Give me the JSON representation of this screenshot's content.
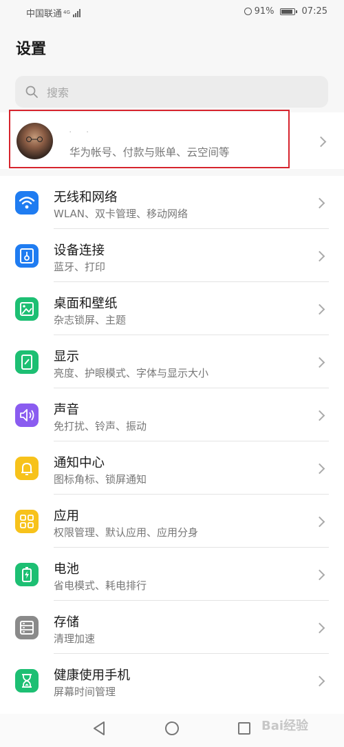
{
  "status_bar": {
    "carrier": "中国联通",
    "network": "4G",
    "battery_percent": "91%",
    "time": "07:25",
    "icons": [
      "signal-icon",
      "alarm-icon",
      "battery-icon"
    ]
  },
  "header": {
    "title": "设置"
  },
  "search": {
    "placeholder": "搜索"
  },
  "account": {
    "name": "· ·",
    "subtitle": "华为帐号、付款与账单、云空间等"
  },
  "settings": [
    {
      "title": "无线和网络",
      "subtitle": "WLAN、双卡管理、移动网络",
      "icon": "wifi-icon",
      "color": "#1f7cf1"
    },
    {
      "title": "设备连接",
      "subtitle": "蓝牙、打印",
      "icon": "device-connection-icon",
      "color": "#1f7cf1"
    },
    {
      "title": "桌面和壁纸",
      "subtitle": "杂志锁屏、主题",
      "icon": "wallpaper-icon",
      "color": "#1dbf73"
    },
    {
      "title": "显示",
      "subtitle": "亮度、护眼模式、字体与显示大小",
      "icon": "display-icon",
      "color": "#1dbf73"
    },
    {
      "title": "声音",
      "subtitle": "免打扰、铃声、振动",
      "icon": "sound-icon",
      "color": "#8a5cf0"
    },
    {
      "title": "通知中心",
      "subtitle": "图标角标、锁屏通知",
      "icon": "notification-icon",
      "color": "#f7c21b"
    },
    {
      "title": "应用",
      "subtitle": "权限管理、默认应用、应用分身",
      "icon": "apps-icon",
      "color": "#f7c21b"
    },
    {
      "title": "电池",
      "subtitle": "省电模式、耗电排行",
      "icon": "battery-setting-icon",
      "color": "#1dbf73"
    },
    {
      "title": "存储",
      "subtitle": "清理加速",
      "icon": "storage-icon",
      "color": "#8a8a8a"
    },
    {
      "title": "健康使用手机",
      "subtitle": "屏幕时间管理",
      "icon": "digital-balance-icon",
      "color": "#1dbf73"
    }
  ],
  "watermark": "Bai经验"
}
